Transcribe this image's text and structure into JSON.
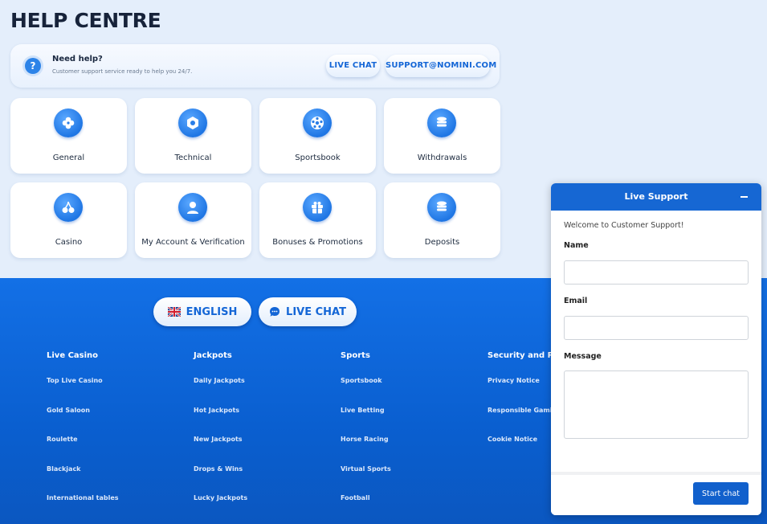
{
  "page": {
    "title": "HELP CENTRE"
  },
  "helpbar": {
    "heading": "Need help?",
    "subtext": "Customer support service ready to help you 24/7.",
    "live_chat_label": "LIVE CHAT",
    "email_label": "SUPPORT@NOMINI.COM"
  },
  "categories": [
    {
      "label": "General",
      "icon": "clover-icon"
    },
    {
      "label": "Technical",
      "icon": "nut-icon"
    },
    {
      "label": "Sportsbook",
      "icon": "ball-icon"
    },
    {
      "label": "Withdrawals",
      "icon": "coins-icon"
    },
    {
      "label": "Casino",
      "icon": "cherries-icon"
    },
    {
      "label": "My Account & Verification",
      "icon": "user-icon"
    },
    {
      "label": "Bonuses & Promotions",
      "icon": "gift-icon"
    },
    {
      "label": "Deposits",
      "icon": "coins-icon"
    }
  ],
  "footer": {
    "language_label": "ENGLISH",
    "live_chat_label": "LIVE CHAT",
    "columns": [
      {
        "heading": "Live Casino",
        "links": [
          "Top Live Casino",
          "Gold Saloon",
          "Roulette",
          "Blackjack",
          "International tables"
        ]
      },
      {
        "heading": "Jackpots",
        "links": [
          "Daily Jackpots",
          "Hot Jackpots",
          "New Jackpots",
          "Drops & Wins",
          "Lucky Jackpots"
        ]
      },
      {
        "heading": "Sports",
        "links": [
          "Sportsbook",
          "Live Betting",
          "Horse Racing",
          "Virtual Sports",
          "Football"
        ]
      },
      {
        "heading": "Security and Priva",
        "links": [
          "Privacy Notice",
          "Responsible Gaming",
          "Cookie Notice"
        ]
      }
    ]
  },
  "chat": {
    "title": "Live Support",
    "welcome": "Welcome to Customer Support!",
    "name_label": "Name",
    "email_label": "Email",
    "message_label": "Message",
    "name_value": "",
    "email_value": "",
    "message_value": "",
    "start_label": "Start chat"
  }
}
